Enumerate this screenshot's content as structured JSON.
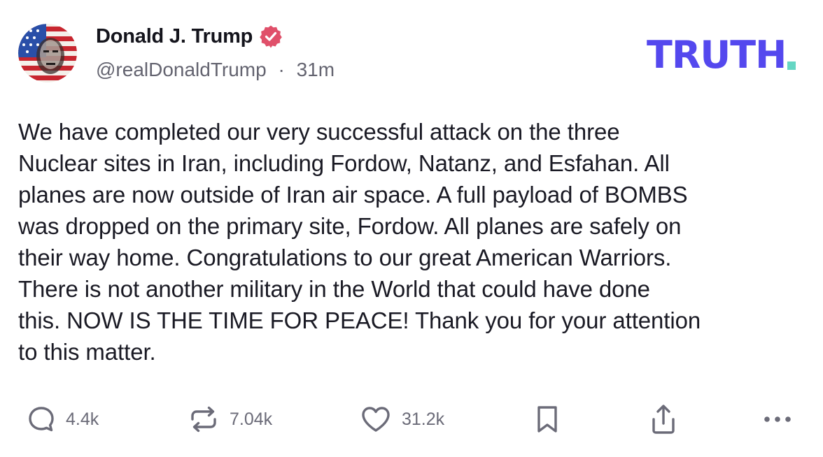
{
  "post": {
    "author": {
      "name": "Donald J. Trump",
      "handle": "@realDonaldTrump",
      "separator": "·",
      "time": "31m",
      "verified": true,
      "avatar_icon": "flag-portrait-avatar"
    },
    "logo": {
      "text": "TRUTH",
      "color": "#5448ee",
      "dot_color": "#65d6c3"
    },
    "body": "We have completed our very successful attack on the three\nNuclear sites in Iran, including Fordow, Natanz, and Esfahan. All\nplanes are now outside of Iran air space. A full payload of BOMBS\nwas dropped on the primary site, Fordow. All planes are safely on\ntheir way home. Congratulations to our great American Warriors.\nThere is not another military in the World that could have done\nthis. NOW IS THE TIME FOR PEACE! Thank you for your attention\nto this matter.",
    "actions": {
      "replies": {
        "icon": "reply-bubble-icon",
        "count": "4.4k"
      },
      "retruths": {
        "icon": "retruth-icon",
        "count": "7.04k"
      },
      "likes": {
        "icon": "heart-icon",
        "count": "31.2k"
      },
      "bookmark": {
        "icon": "bookmark-icon"
      },
      "share": {
        "icon": "share-icon"
      },
      "more": {
        "icon": "more-dots-icon"
      }
    },
    "colors": {
      "verified_badge": "#e0506a",
      "muted_text": "#646470",
      "icon_gray": "#6b6b78"
    }
  }
}
